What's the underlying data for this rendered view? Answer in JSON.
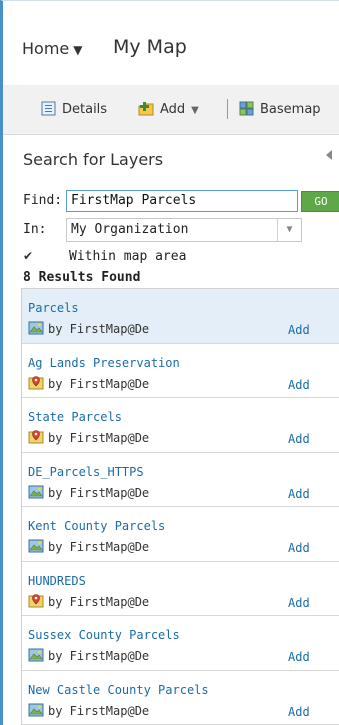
{
  "header": {
    "home_label": "Home",
    "map_title": "My Map"
  },
  "toolbar": {
    "details_label": "Details",
    "add_label": "Add",
    "basemap_label": "Basemap"
  },
  "panel": {
    "title": "Search for Layers",
    "find_label": "Find:",
    "find_value": "FirstMap Parcels",
    "go_label": "GO",
    "in_label": "In:",
    "in_value": "My Organization",
    "within_label": "Within map area",
    "within_checked": true,
    "results_count": "8 Results Found"
  },
  "results": [
    {
      "name": "Parcels",
      "owner": "by FirstMap@De",
      "add": "Add",
      "icon": "map-image-icon"
    },
    {
      "name": "Ag Lands Preservation",
      "owner": "by FirstMap@De",
      "add": "Add",
      "icon": "feature-layer-icon"
    },
    {
      "name": "State Parcels",
      "owner": "by FirstMap@De",
      "add": "Add",
      "icon": "feature-layer-icon"
    },
    {
      "name": "DE_Parcels_HTTPS",
      "owner": "by FirstMap@De",
      "add": "Add",
      "icon": "map-image-icon"
    },
    {
      "name": "Kent County Parcels",
      "owner": "by FirstMap@De",
      "add": "Add",
      "icon": "map-image-icon"
    },
    {
      "name": "HUNDREDS",
      "owner": "by FirstMap@De",
      "add": "Add",
      "icon": "feature-layer-icon"
    },
    {
      "name": "Sussex County Parcels",
      "owner": "by FirstMap@De",
      "add": "Add",
      "icon": "map-image-icon"
    },
    {
      "name": "New Castle County Parcels",
      "owner": "by FirstMap@De",
      "add": "Add",
      "icon": "map-image-icon"
    }
  ]
}
